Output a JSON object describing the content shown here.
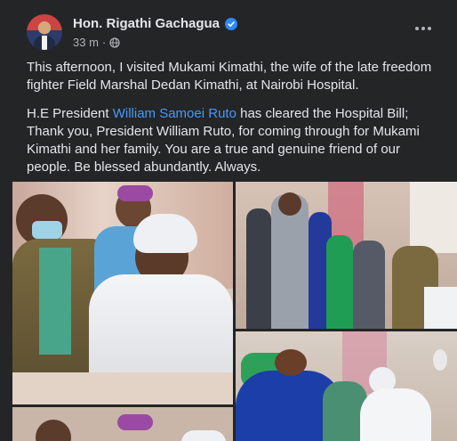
{
  "post": {
    "author": "Hon. Rigathi Gachagua",
    "timestamp": "33 m",
    "separator": "·",
    "paragraph1": "This afternoon, I visited Mukami Kimathi, the wife of the late freedom fighter Field Marshal Dedan Kimathi, at Nairobi Hospital.",
    "paragraph2_pre": "H.E President ",
    "paragraph2_link": "William Samoei Ruto",
    "paragraph2_post": " has cleared the Hospital Bill; Thank you, President William Ruto, for coming through for Mukami Kimathi and her family. You are a true and genuine friend of our people. Be blessed abundantly. Always."
  },
  "icons": {
    "verified": "verified-badge-icon",
    "audience": "globe-icon",
    "more": "more-options-icon"
  },
  "colors": {
    "background": "#242526",
    "link": "#4599ff",
    "verified": "#2d88ff",
    "secondary_text": "#b0b3b8"
  }
}
